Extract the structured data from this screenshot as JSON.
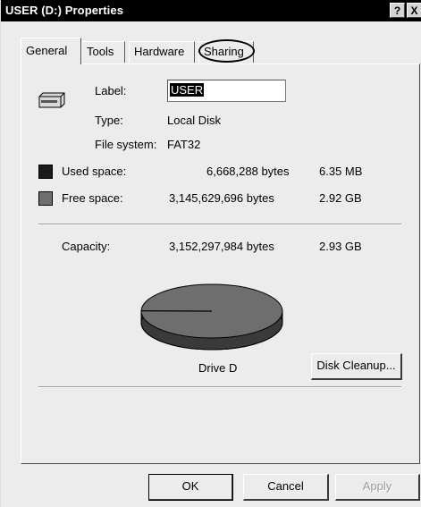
{
  "window": {
    "title": "USER (D:) Properties"
  },
  "titlebar": {
    "help_label": "?",
    "close_label": "X"
  },
  "tabs": [
    {
      "label": "General",
      "active": true
    },
    {
      "label": "Tools",
      "active": false
    },
    {
      "label": "Hardware",
      "active": false
    },
    {
      "label": "Sharing",
      "active": false,
      "circled": true
    }
  ],
  "general": {
    "drive_icon": "drive-icon",
    "label_caption": "Label:",
    "label_value": "USER",
    "type_caption": "Type:",
    "type_value": "Local Disk",
    "fs_caption": "File system:",
    "fs_value": "FAT32",
    "used": {
      "caption": "Used space:",
      "bytes": "6,668,288 bytes",
      "size": "6.35 MB",
      "color": "#1a1a1a"
    },
    "free": {
      "caption": "Free space:",
      "bytes": "3,145,629,696 bytes",
      "size": "2.92 GB",
      "color": "#6e6e6e"
    },
    "capacity": {
      "caption": "Capacity:",
      "bytes": "3,152,297,984 bytes",
      "size": "2.93 GB"
    },
    "used_fraction": 0.0021,
    "drive_name": "Drive D",
    "disk_cleanup_label": "Disk Cleanup..."
  },
  "buttons": {
    "ok": "OK",
    "cancel": "Cancel",
    "apply": "Apply"
  }
}
